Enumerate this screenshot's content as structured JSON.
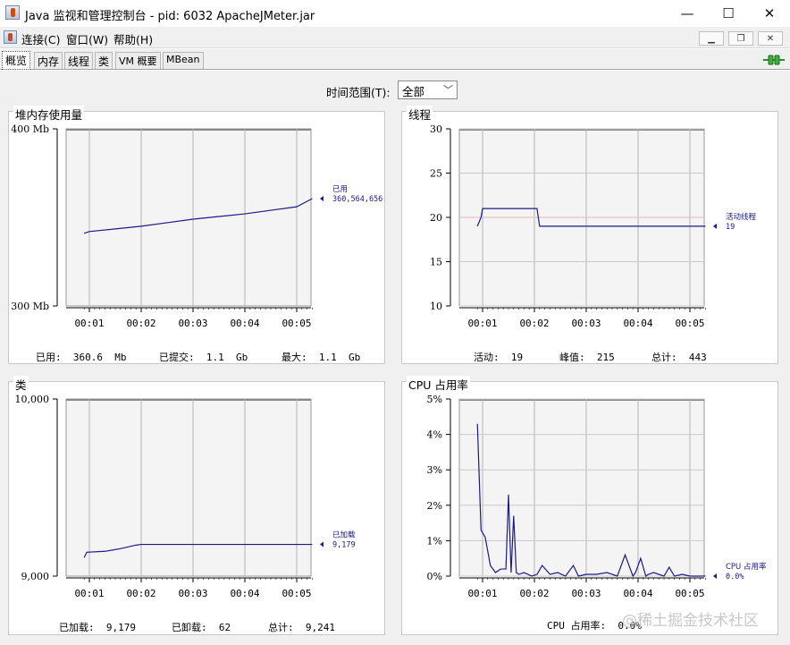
{
  "window": {
    "title": "Java 监视和管理控制台 - pid: 6032 ApacheJMeter.jar",
    "minimize": "—",
    "maximize": "☐",
    "close": "✕",
    "icon": "java-cup-icon"
  },
  "menu": {
    "items": [
      "连接(C)",
      "窗口(W)",
      "帮助(H)"
    ],
    "mdi_buttons": [
      "▁",
      "❐",
      "✕"
    ]
  },
  "tabs": [
    "概览",
    "内存",
    "线程",
    "类",
    "VM 概要",
    "MBean"
  ],
  "active_tab": "概览",
  "time_range": {
    "label": "时间范围(T):",
    "value": "全部"
  },
  "panels": {
    "heap": {
      "title": "堆内存使用量",
      "y_ticks": [
        "400 Mb",
        "300 Mb"
      ],
      "x_ticks": [
        "00:01",
        "00:02",
        "00:03",
        "00:04",
        "00:05"
      ],
      "legend": {
        "name": "已用",
        "value": "360,564,656"
      },
      "stats": [
        "已用:  360.6  Mb",
        "已提交:  1.1  Gb",
        "最大:  1.1  Gb"
      ]
    },
    "threads": {
      "title": "线程",
      "y_ticks": [
        "30",
        "25",
        "20",
        "15",
        "10"
      ],
      "x_ticks": [
        "00:01",
        "00:02",
        "00:03",
        "00:04",
        "00:05"
      ],
      "legend": {
        "name": "活动线程",
        "value": "19"
      },
      "stats": [
        "活动:  19",
        "峰值:  215",
        "总计:  443"
      ]
    },
    "classes": {
      "title": "类",
      "y_ticks": [
        "10,000",
        "9,000"
      ],
      "x_ticks": [
        "00:01",
        "00:02",
        "00:03",
        "00:04",
        "00:05"
      ],
      "legend": {
        "name": "已加载",
        "value": "9,179"
      },
      "stats": [
        "已加载:  9,179",
        "已卸载:  62",
        "总计:  9,241"
      ]
    },
    "cpu": {
      "title": "CPU 占用率",
      "y_ticks": [
        "5%",
        "4%",
        "3%",
        "2%",
        "1%",
        "0%"
      ],
      "x_ticks": [
        "00:01",
        "00:02",
        "00:03",
        "00:04",
        "00:05"
      ],
      "legend": {
        "name": "CPU 占用率",
        "value": "0.0%"
      },
      "stats": [
        "CPU 占用率:  0.0%"
      ]
    }
  },
  "chart_data": [
    {
      "type": "line",
      "title": "堆内存使用量",
      "ylim": [
        300,
        400
      ],
      "y_unit": "Mb",
      "x": [
        0.9,
        1.0,
        1.5,
        2.0,
        2.5,
        3.0,
        3.5,
        4.0,
        4.5,
        5.0,
        5.3
      ],
      "series": [
        {
          "name": "已用",
          "values": [
            341,
            342,
            343.5,
            345,
            347,
            349,
            350.5,
            352,
            354,
            356,
            360.6
          ]
        }
      ]
    },
    {
      "type": "line",
      "title": "线程",
      "ylim": [
        10,
        30
      ],
      "x": [
        0.9,
        0.97,
        1.0,
        1.8,
        2.05,
        2.1,
        3.0,
        4.0,
        5.0,
        5.3
      ],
      "series": [
        {
          "name": "活动线程",
          "values": [
            19,
            20,
            21,
            21,
            21,
            19,
            19,
            19,
            19,
            19
          ]
        }
      ],
      "peak_line": 20
    },
    {
      "type": "line",
      "title": "类",
      "ylim": [
        9000,
        10000
      ],
      "x": [
        0.9,
        0.95,
        1.3,
        1.6,
        1.9,
        2.0,
        3.0,
        4.0,
        5.0,
        5.3
      ],
      "series": [
        {
          "name": "已加载",
          "values": [
            9105,
            9135,
            9140,
            9155,
            9175,
            9179,
            9179,
            9179,
            9179,
            9179
          ]
        }
      ]
    },
    {
      "type": "line",
      "title": "CPU 占用率",
      "ylim": [
        0,
        5
      ],
      "y_unit": "%",
      "x": [
        0.9,
        0.97,
        1.05,
        1.15,
        1.25,
        1.35,
        1.45,
        1.5,
        1.55,
        1.6,
        1.65,
        1.7,
        1.8,
        1.95,
        2.05,
        2.15,
        2.3,
        2.45,
        2.6,
        2.75,
        2.85,
        3.0,
        3.2,
        3.4,
        3.6,
        3.75,
        3.9,
        3.95,
        4.05,
        4.15,
        4.2,
        4.3,
        4.5,
        4.6,
        4.7,
        4.85,
        5.0,
        5.3
      ],
      "series": [
        {
          "name": "CPU 占用率",
          "values": [
            4.3,
            1.3,
            1.1,
            0.3,
            0.1,
            0.2,
            0.2,
            2.3,
            0.1,
            1.7,
            0.1,
            0.05,
            0.1,
            0,
            0.05,
            0.3,
            0.05,
            0.1,
            0,
            0.3,
            0,
            0.05,
            0.05,
            0.1,
            0,
            0.6,
            0,
            0.1,
            0.5,
            0,
            0.05,
            0.1,
            0,
            0.25,
            0,
            0.05,
            0,
            0
          ]
        }
      ]
    }
  ],
  "watermark": "@稀土掘金技术社区"
}
